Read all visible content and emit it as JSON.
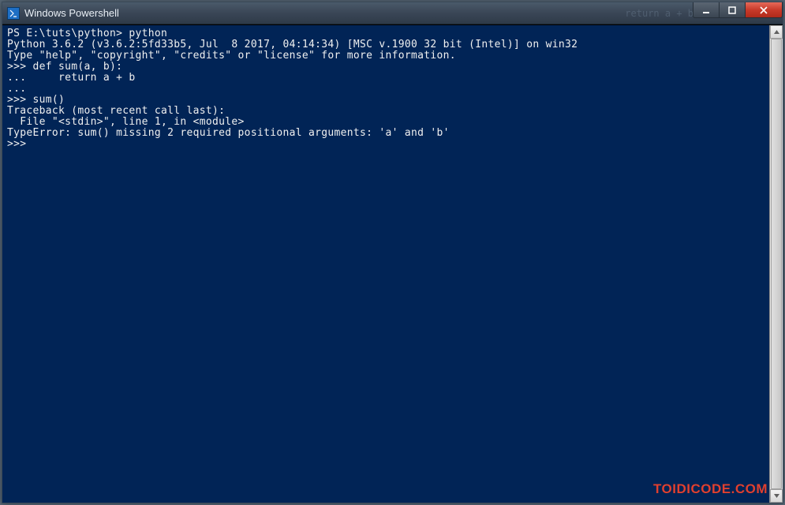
{
  "window": {
    "title": "Windows Powershell",
    "ghost_text": "return a + b"
  },
  "terminal": {
    "lines": [
      "PS E:\\tuts\\python> python",
      "Python 3.6.2 (v3.6.2:5fd33b5, Jul  8 2017, 04:14:34) [MSC v.1900 32 bit (Intel)] on win32",
      "Type \"help\", \"copyright\", \"credits\" or \"license\" for more information.",
      ">>> def sum(a, b):",
      "...     return a + b",
      "...",
      ">>> sum()",
      "Traceback (most recent call last):",
      "  File \"<stdin>\", line 1, in <module>",
      "TypeError: sum() missing 2 required positional arguments: 'a' and 'b'",
      ">>>"
    ]
  },
  "watermark": "TOIDICODE.COM"
}
